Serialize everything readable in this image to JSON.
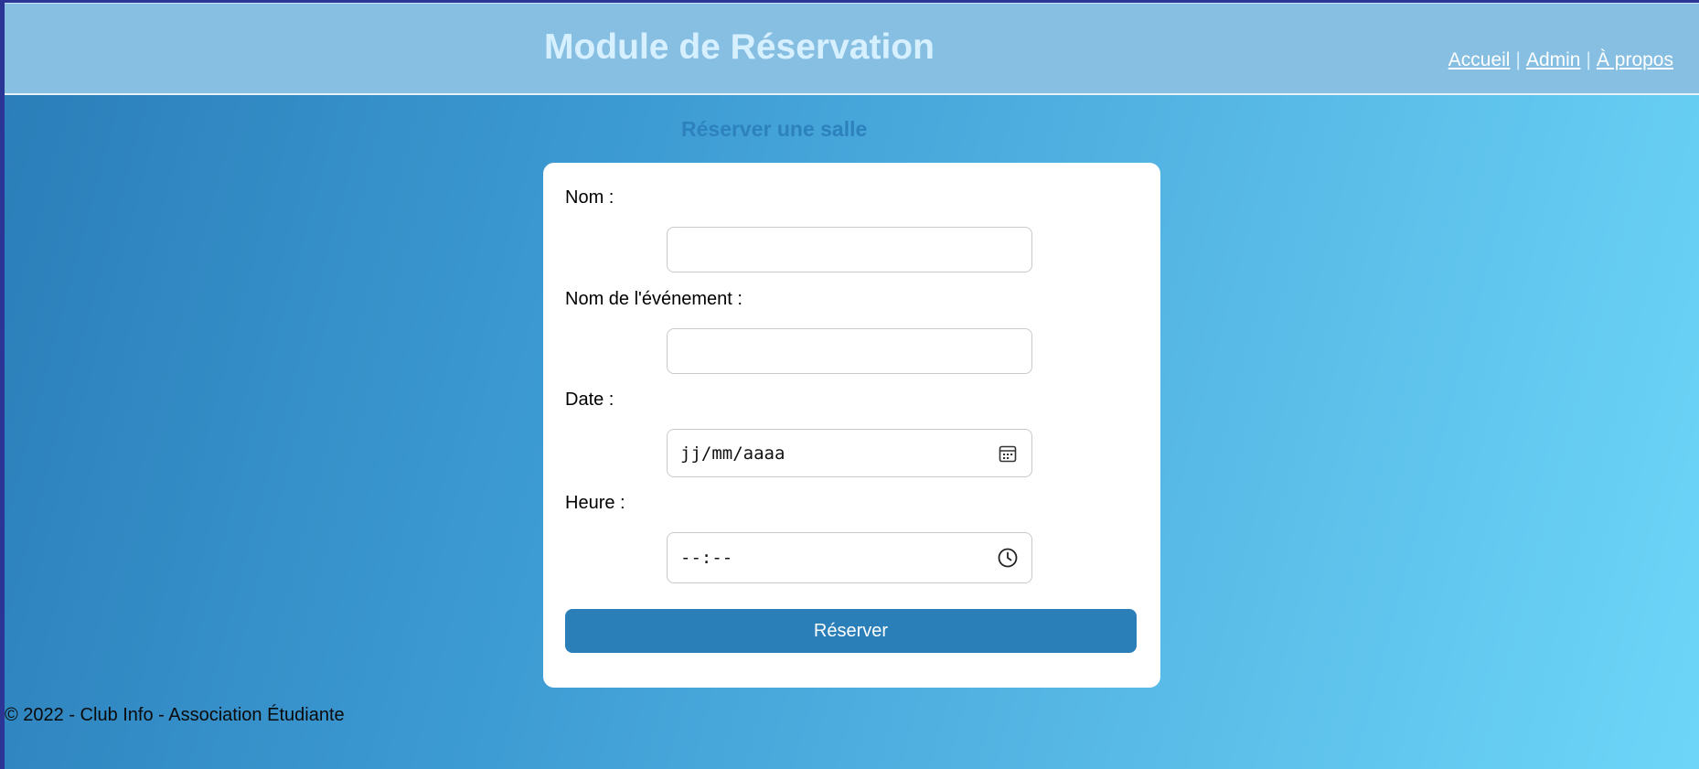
{
  "header": {
    "title": "Module de Réservation",
    "nav": [
      {
        "label": "Accueil"
      },
      {
        "label": "Admin"
      },
      {
        "label": "À propos"
      }
    ],
    "separator": "|"
  },
  "form": {
    "title": "Réserver une salle",
    "fields": {
      "nom": {
        "label": "Nom :",
        "value": ""
      },
      "evenement": {
        "label": "Nom de l'événement :",
        "value": ""
      },
      "date": {
        "label": "Date :",
        "placeholder": "jj/mm/aaaa",
        "icon": "calendar-icon"
      },
      "heure": {
        "label": "Heure :",
        "placeholder": "--:--",
        "icon": "clock-icon"
      }
    },
    "submit_label": "Réserver"
  },
  "footer": {
    "text": "© 2022 - Club Info - Association Étudiante"
  },
  "colors": {
    "header_bg": "#87bfe2",
    "button_bg": "#2a7fb8",
    "title_text": "#d7f0ff",
    "form_title": "#2d82bd"
  }
}
